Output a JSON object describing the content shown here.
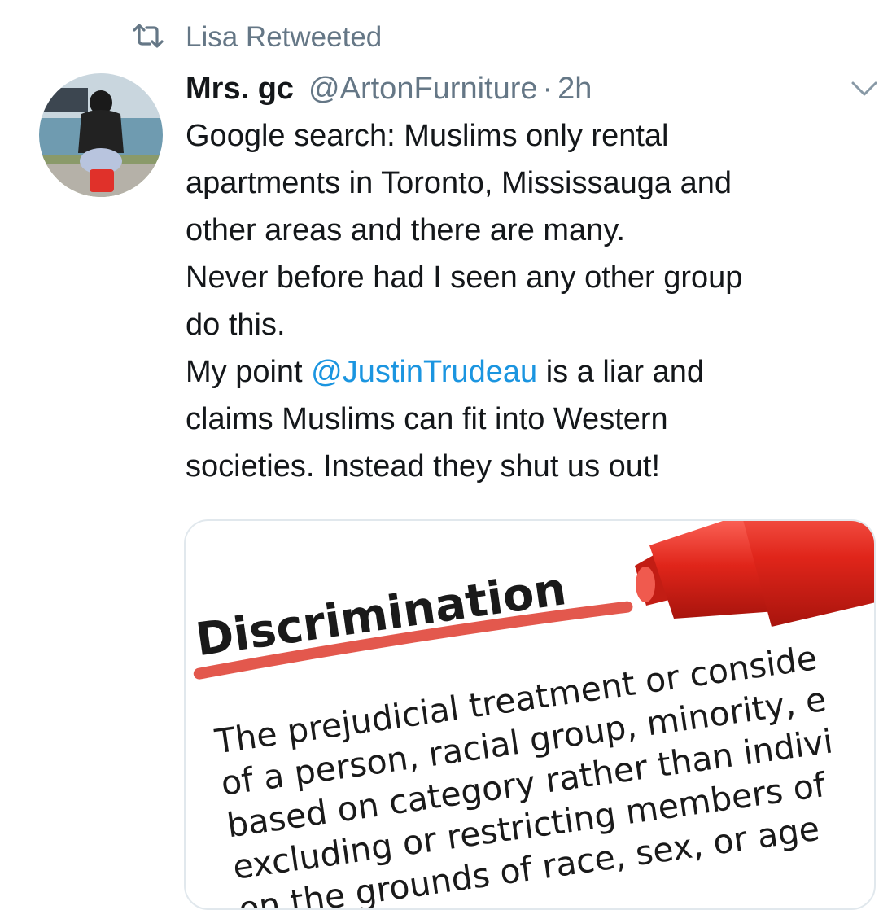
{
  "retweet": {
    "icon": "retweet-icon",
    "label": "Lisa Retweeted"
  },
  "tweet": {
    "avatar_icon": "avatar-photo",
    "display_name": "Mrs. gc",
    "handle": "@ArtonFurniture",
    "separator": "·",
    "time": "2h",
    "menu_icon": "chevron-down-icon",
    "lines": {
      "l1": "Google search: Muslims only rental",
      "l2": "apartments in Toronto, Mississauga and",
      "l3": "other areas and there are many.",
      "l4": "Never before had I seen any other group",
      "l5": "do this.",
      "l6_pre": "My point ",
      "l6_mention": "@JustinTrudeau",
      "l6_post": " is a liar and",
      "l7": "claims Muslims can fit into Western",
      "l8": "societies. Instead they shut us out!"
    }
  },
  "media": {
    "heading": "Discrimination",
    "lines": [
      "The prejudicial treatment or conside",
      "of a person, racial group, minority, e",
      "based on category rather than indivi",
      "excluding or restricting members of",
      "on the grounds of race, sex, or age"
    ],
    "colors": {
      "marker": "#d9261c",
      "underline": "#e0463a",
      "text": "#1a1a1a",
      "mention": "#1b95e0",
      "muted": "#657786"
    }
  }
}
